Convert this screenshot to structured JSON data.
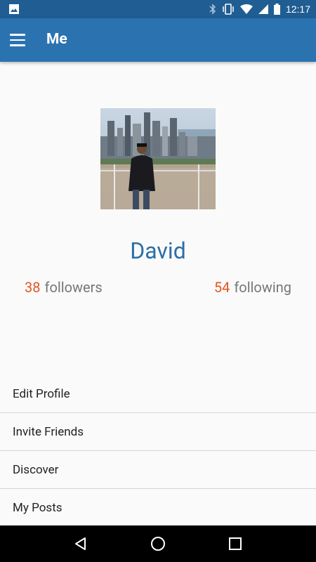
{
  "status_bar": {
    "time": "12:17",
    "left_icon": "image-icon",
    "right_icons": [
      "bluetooth-icon",
      "vibrate-icon",
      "wifi-icon",
      "signal-icon",
      "battery-icon"
    ]
  },
  "app_bar": {
    "title": "Me",
    "menu_icon": "hamburger-menu-icon",
    "background": "#2b73b0"
  },
  "profile": {
    "name": "David",
    "followers_count": "38",
    "followers_label": "followers",
    "following_count": "54",
    "following_label": "following",
    "accent_color": "#e2581d",
    "name_color": "#2b6ea8"
  },
  "menu": {
    "items": [
      {
        "label": "Edit Profile"
      },
      {
        "label": "Invite Friends"
      },
      {
        "label": "Discover"
      },
      {
        "label": "My Posts"
      }
    ]
  },
  "nav_bar": {
    "buttons": [
      "back-icon",
      "home-icon",
      "recents-icon"
    ]
  }
}
